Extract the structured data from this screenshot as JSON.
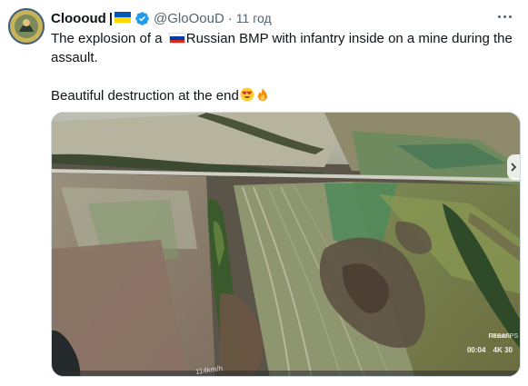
{
  "user": {
    "display_name": "Cloooud",
    "separator": "|",
    "handle": "@GloOouD",
    "dot": "·",
    "time": "11 год"
  },
  "tweet": {
    "line1_before_flag": "The explosion of a ",
    "line1_after_flag": "Russian BMP with infantry inside on a mine during the assault.",
    "line2": "Beautiful destruction at the end"
  },
  "video": {
    "memory_label": "Память",
    "rec_label": "RES&FPS",
    "timestamp": "00:04",
    "quality": "4K 30",
    "speed": "114km/h"
  },
  "icons": {
    "verified": "verified-badge-icon",
    "more": "more-dots-icon",
    "emoji_heart_eyes": "heart-eyes-emoji-icon",
    "emoji_fire": "fire-emoji-icon",
    "flag_ua": "ukraine-flag-icon",
    "flag_ru": "russia-flag-icon"
  },
  "colors": {
    "verified_blue": "#1d9bf0",
    "secondary_text": "#536471",
    "ua_blue": "#0057b7",
    "ua_yellow": "#ffd700",
    "ru_white": "#ffffff",
    "ru_blue": "#0039a6",
    "ru_red": "#d52b1e"
  }
}
